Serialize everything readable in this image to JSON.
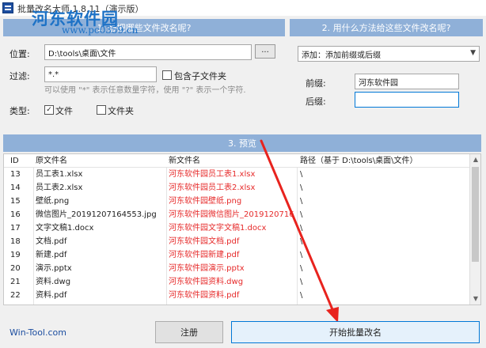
{
  "window": {
    "title": "批量改名大师 1.8.11（演示版）"
  },
  "watermark": {
    "text": "河东软件园",
    "url": "www.pc0359.cn"
  },
  "step1": {
    "header": "1. 想把哪些文件改名呢?",
    "location_label": "位置:",
    "location_value": "D:\\tools\\桌面\\文件",
    "browse_label": "...",
    "filter_label": "过滤:",
    "filter_value": "*.*",
    "include_subfolders_label": "包含子文件夹",
    "hint": "可以使用 \"*\" 表示任意数量字符，使用 \"?\" 表示一个字符.",
    "type_label": "类型:",
    "file_label": "文件",
    "folder_label": "文件夹"
  },
  "step2": {
    "header": "2. 用什么方法给这些文件改名呢?",
    "method_value": "添加：添加前缀或后缀",
    "prefix_label": "前缀:",
    "prefix_value": "河东软件园",
    "suffix_label": "后缀:",
    "suffix_value": ""
  },
  "preview": {
    "header": "3. 预览",
    "columns": {
      "id": "ID",
      "original": "原文件名",
      "new": "新文件名",
      "path": "路径（基于 D:\\tools\\桌面\\文件）"
    },
    "rows": [
      {
        "id": "13",
        "original": "员工表1.xlsx",
        "new": "河东软件园员工表1.xlsx",
        "path": "\\"
      },
      {
        "id": "14",
        "original": "员工表2.xlsx",
        "new": "河东软件园员工表2.xlsx",
        "path": "\\"
      },
      {
        "id": "15",
        "original": "壁纸.png",
        "new": "河东软件园壁纸.png",
        "path": "\\"
      },
      {
        "id": "16",
        "original": "微信图片_20191207164553.jpg",
        "new": "河东软件园微信图片_2019120716...",
        "path": "\\"
      },
      {
        "id": "17",
        "original": "文字文稿1.docx",
        "new": "河东软件园文字文稿1.docx",
        "path": "\\"
      },
      {
        "id": "18",
        "original": "文档.pdf",
        "new": "河东软件园文档.pdf",
        "path": "\\"
      },
      {
        "id": "19",
        "original": "新建.pdf",
        "new": "河东软件园新建.pdf",
        "path": "\\"
      },
      {
        "id": "20",
        "original": "演示.pptx",
        "new": "河东软件园演示.pptx",
        "path": "\\"
      },
      {
        "id": "21",
        "original": "资料.dwg",
        "new": "河东软件园资料.dwg",
        "path": "\\"
      },
      {
        "id": "22",
        "original": "资料.pdf",
        "new": "河东软件园资料.pdf",
        "path": "\\"
      }
    ]
  },
  "footer": {
    "link": "Win-Tool.com",
    "register_label": "注册",
    "start_label": "开始批量改名"
  },
  "colors": {
    "header_bg": "#8fb0d8",
    "new_name": "#e62a2a",
    "arrow": "#e8231e",
    "link": "#1d4ea0"
  }
}
